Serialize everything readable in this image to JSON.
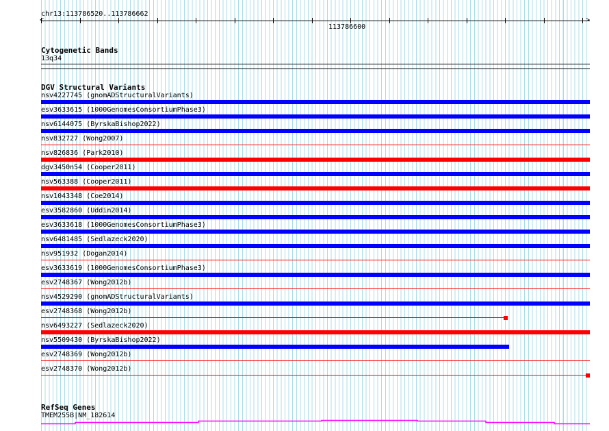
{
  "position": "chr13:113786520..113786662",
  "ruler_label": "113786600",
  "colors": {
    "gain": "#0000ff",
    "loss": "#ff0000",
    "gene": "#ff00ff",
    "grid": "#a8dde8"
  },
  "cytoband": {
    "title": "Cytogenetic Bands",
    "band": "13q34"
  },
  "dgv": {
    "title": "DGV Structural Variants",
    "items": [
      {
        "label": "nsv4227745 (gnomADStructuralVariants)",
        "type": "gain",
        "style": "thick",
        "extent": 1
      },
      {
        "label": "esv3633615 (1000GenomesConsortiumPhase3)",
        "type": "gain",
        "style": "thick",
        "extent": 1
      },
      {
        "label": "nsv6144075 (ByrskaBishop2022)",
        "type": "gain",
        "style": "thick",
        "extent": 1
      },
      {
        "label": "nsv832727 (Wong2007)",
        "type": "loss",
        "style": "thin",
        "extent": 1
      },
      {
        "label": "nsv826836 (Park2010)",
        "type": "loss",
        "style": "thick",
        "extent": 1
      },
      {
        "label": "dgv3450n54 (Cooper2011)",
        "type": "gain",
        "style": "thick",
        "extent": 1
      },
      {
        "label": "nsv563388 (Cooper2011)",
        "type": "loss",
        "style": "thick",
        "extent": 1
      },
      {
        "label": "nsv1043348 (Coe2014)",
        "type": "gain",
        "style": "thick",
        "extent": 1
      },
      {
        "label": "esv3582860 (Uddin2014)",
        "type": "gain",
        "style": "thick",
        "extent": 1
      },
      {
        "label": "esv3633618 (1000GenomesConsortiumPhase3)",
        "type": "gain",
        "style": "thick",
        "extent": 1
      },
      {
        "label": "nsv6481485 (Sedlazeck2020)",
        "type": "gain",
        "style": "thick",
        "extent": 1
      },
      {
        "label": "nsv951932 (Dogan2014)",
        "type": "loss",
        "style": "thin",
        "extent": 1
      },
      {
        "label": "esv3633619 (1000GenomesConsortiumPhase3)",
        "type": "gain",
        "style": "thick",
        "extent": 1
      },
      {
        "label": "esv2748367 (Wong2012b)",
        "type": "loss",
        "style": "thin",
        "extent": 1
      },
      {
        "label": "nsv4529290 (gnomADStructuralVariants)",
        "type": "gain",
        "style": "thick",
        "extent": 1
      },
      {
        "label": "esv2748368 (Wong2012b)",
        "type": "loss",
        "style": "thin-end",
        "extent": 0.85
      },
      {
        "label": "nsv6493227 (Sedlazeck2020)",
        "type": "loss",
        "style": "thick",
        "extent": 1
      },
      {
        "label": "nsv5509430 (ByrskaBishop2022)",
        "type": "gain",
        "style": "thick",
        "extent": 0.853
      },
      {
        "label": "esv2748369 (Wong2012b)",
        "type": "loss",
        "style": "thin",
        "extent": 1
      },
      {
        "label": "esv2748370 (Wong2012b)",
        "type": "loss",
        "style": "thin-end",
        "extent": 1
      }
    ]
  },
  "refseq": {
    "title": "RefSeq Genes",
    "gene": "TMEM255B|NM_182614"
  }
}
